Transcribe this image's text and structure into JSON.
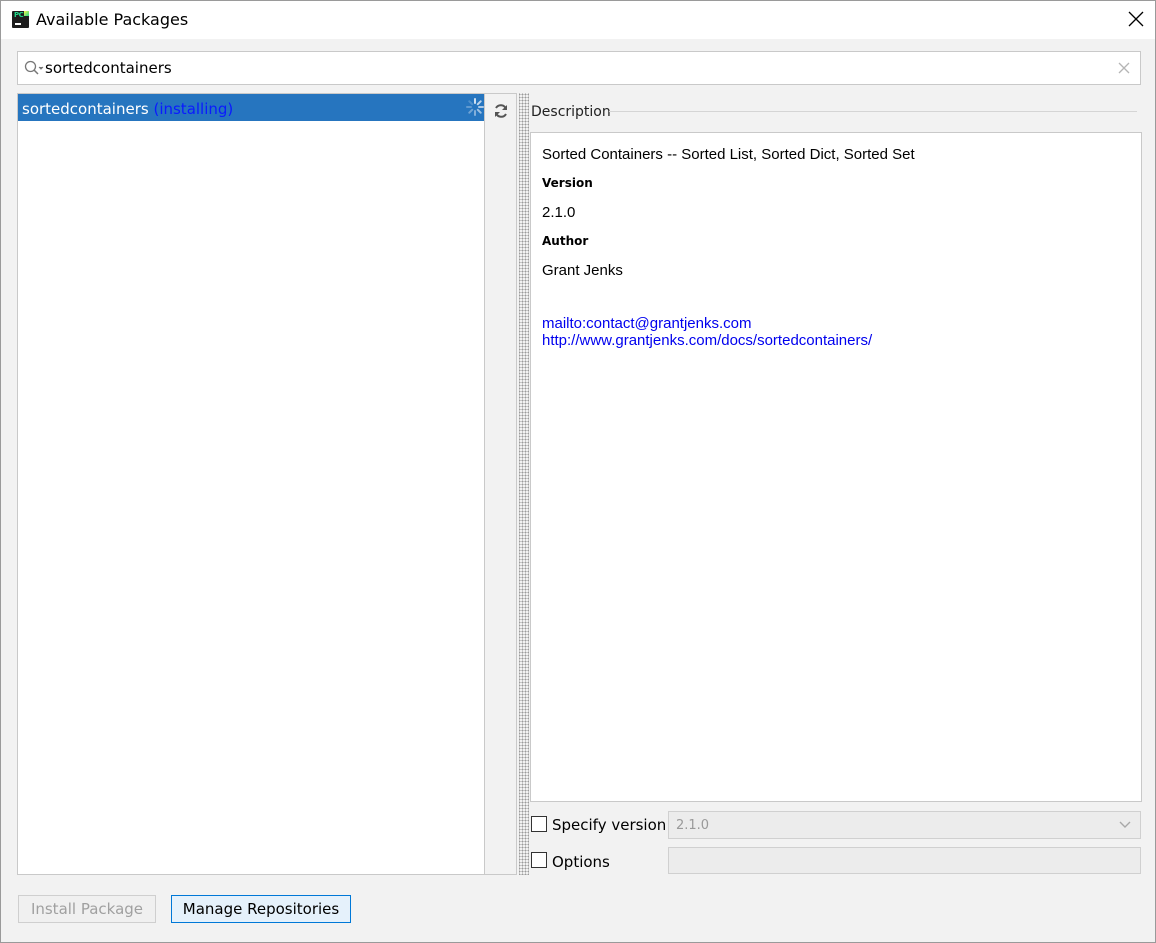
{
  "window": {
    "title": "Available Packages",
    "app_icon_label": "PC"
  },
  "search": {
    "value": "sortedcontainers"
  },
  "packages": [
    {
      "name": "sortedcontainers",
      "status": "(installing)"
    }
  ],
  "description": {
    "section_label": "Description",
    "summary": "Sorted Containers -- Sorted List, Sorted Dict, Sorted Set",
    "version_label": "Version",
    "version_value": "2.1.0",
    "author_label": "Author",
    "author_value": "Grant Jenks",
    "links": [
      "mailto:contact@grantjenks.com",
      "http://www.grantjenks.com/docs/sortedcontainers/"
    ]
  },
  "options": {
    "specify_version_label": "Specify version",
    "specify_version_checked": false,
    "version_selected": "2.1.0",
    "options_label": "Options",
    "options_checked": false,
    "options_value": ""
  },
  "buttons": {
    "install_label": "Install Package",
    "manage_label": "Manage Repositories"
  },
  "colors": {
    "selection": "#2675bf",
    "installing_status": "#0a1aff",
    "link": "#0000ee",
    "focus_border": "#0078d7"
  },
  "icons": {
    "app": "pycharm-icon",
    "close": "close-icon",
    "search": "search-icon",
    "clear": "clear-icon",
    "spinner": "loading-spinner-icon",
    "refresh": "refresh-icon",
    "dropdown": "chevron-down-icon"
  }
}
